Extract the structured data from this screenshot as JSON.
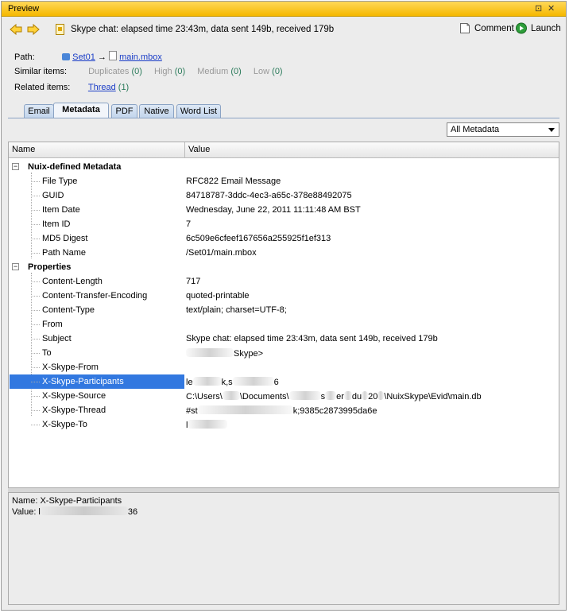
{
  "window": {
    "title": "Preview",
    "restore_glyph": "⊡",
    "close_glyph": "✕"
  },
  "toolbar": {
    "item_title": "Skype chat: elapsed time 23:43m, data sent 149b, received 179b",
    "comment_label": "Comment",
    "launch_label": "Launch"
  },
  "info": {
    "path_label": "Path:",
    "path_set": "Set01",
    "path_arrow": "→",
    "path_file": "main.mbox",
    "similar_label": "Similar items:",
    "duplicates": "Duplicates",
    "duplicates_count": "(0)",
    "high": "High",
    "high_count": "(0)",
    "medium": "Medium",
    "medium_count": "(0)",
    "low": "Low",
    "low_count": "(0)",
    "related_label": "Related items:",
    "thread": "Thread",
    "thread_count": "(1)"
  },
  "tabs": [
    "Email",
    "Metadata",
    "PDF",
    "Native",
    "Word List"
  ],
  "active_tab": "Metadata",
  "filter": {
    "selected": "All Metadata"
  },
  "table": {
    "col_name": "Name",
    "col_value": "Value",
    "group1": "Nuix-defined Metadata",
    "group2": "Properties",
    "toggle": "−",
    "rows1": [
      {
        "name": "File Type",
        "value": "RFC822 Email Message"
      },
      {
        "name": "GUID",
        "value": "84718787-3ddc-4ec3-a65c-378e88492075"
      },
      {
        "name": "Item Date",
        "value": "Wednesday, June 22, 2011 11:11:48 AM BST"
      },
      {
        "name": "Item ID",
        "value": "7"
      },
      {
        "name": "MD5 Digest",
        "value": "6c509e6cfeef167656a255925f1ef313"
      },
      {
        "name": "Path Name",
        "value": "/Set01/main.mbox"
      }
    ],
    "rows2": [
      {
        "name": "Content-Length",
        "value": "717"
      },
      {
        "name": "Content-Transfer-Encoding",
        "value": "quoted-printable"
      },
      {
        "name": "Content-Type",
        "value": "text/plain; charset=UTF-8;"
      },
      {
        "name": "From",
        "value": ""
      },
      {
        "name": "Subject",
        "value": "Skype chat: elapsed time 23:43m, data sent 149b, received 179b"
      },
      {
        "name": "To",
        "value": "Skype>"
      },
      {
        "name": "X-Skype-From",
        "value": ""
      },
      {
        "name": "X-Skype-Participants",
        "value": "le"
      },
      {
        "name": "X-Skype-Source",
        "value": "C:\\Users\\"
      },
      {
        "name": "X-Skype-Thread",
        "value": "#st"
      },
      {
        "name": "X-Skype-To",
        "value": "l"
      }
    ],
    "participants_tail1": "k,s",
    "participants_tail2": "6",
    "source_mid1": "\\Documents\\",
    "source_mid2": "s",
    "source_mid3": "er",
    "source_mid4": "du",
    "source_mid5": "20",
    "source_tail": "\\NuixSkype\\Evid\\main.db",
    "thread_tail": "k;9385c2873995da6e"
  },
  "detail": {
    "name_line": "Name: X-Skype-Participants",
    "value_prefix": "Value: l",
    "value_tail": "36"
  }
}
